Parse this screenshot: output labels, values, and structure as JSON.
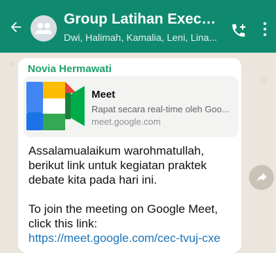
{
  "header": {
    "title": "Group Latihan Executive",
    "subtitle": "Dwi, Halimah, Kamalia, Leni, Lina...",
    "background": "#0f8a6f",
    "icons": [
      "back-arrow-icon",
      "group-avatar-icon",
      "add-call-icon",
      "more-menu-icon"
    ]
  },
  "message": {
    "sender": "Novia Hermawati",
    "preview": {
      "title": "Meet",
      "description": "Rapat secara real-time oleh Goo...",
      "domain": "meet.google.com",
      "icon": "google-meet-logo"
    },
    "text_lines": [
      "Assalamualaikum warohmatullah,",
      "berikut link untuk kegiatan praktek",
      "debate kita pada hari ini.",
      "",
      "To join the meeting on Google Meet,",
      "click this link:"
    ],
    "link": "https://meet.google.com/cec-tvuj-cxe"
  },
  "actions": {
    "forward_icon": "forward-icon"
  }
}
